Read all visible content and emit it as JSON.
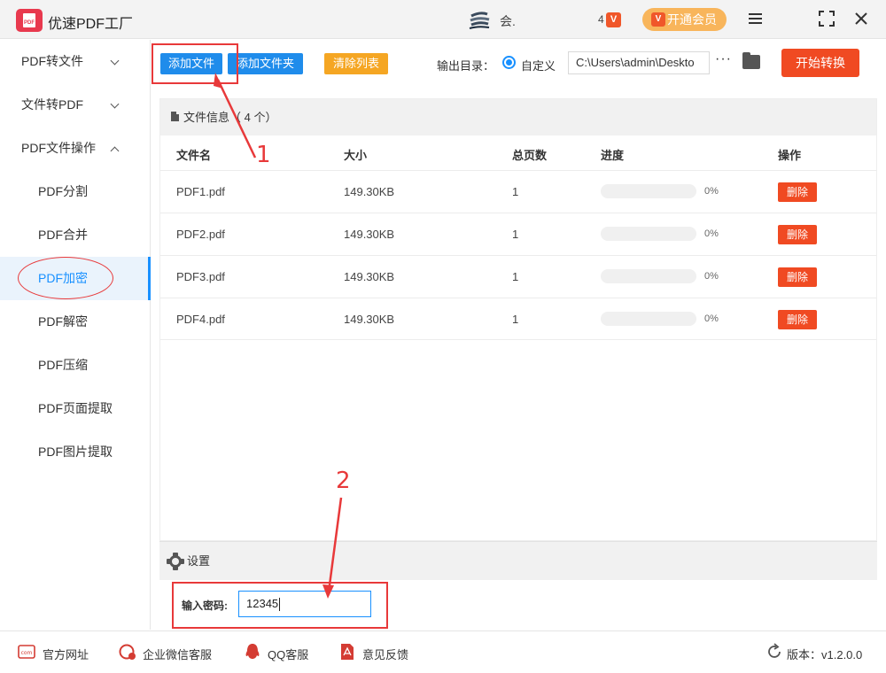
{
  "window": {
    "title": "优速PDF工厂",
    "logo_text": "PDF",
    "user_name": "会.",
    "vip_level": "4",
    "vip_badge": "V",
    "vip_button_label": "开通会员",
    "vip_button_badge": "V"
  },
  "sidebar": {
    "groups": [
      {
        "label": "PDF转文件",
        "expanded": false
      },
      {
        "label": "文件转PDF",
        "expanded": false
      },
      {
        "label": "PDF文件操作",
        "expanded": true
      }
    ],
    "items": [
      {
        "label": "PDF分割"
      },
      {
        "label": "PDF合并"
      },
      {
        "label": "PDF加密",
        "active": true
      },
      {
        "label": "PDF解密"
      },
      {
        "label": "PDF压缩"
      },
      {
        "label": "PDF页面提取"
      },
      {
        "label": "PDF图片提取"
      }
    ]
  },
  "toolbar": {
    "add_file": "添加文件",
    "add_folder": "添加文件夹",
    "clear_list": "清除列表",
    "output_label": "输出目录：",
    "radio_custom": "自定义",
    "output_path": "C:\\Users\\admin\\Deskto",
    "more": "···",
    "start": "开始转换"
  },
  "files": {
    "header": "文件信息（ 4 个）",
    "columns": [
      "文件名",
      "大小",
      "总页数",
      "进度",
      "操作"
    ],
    "rows": [
      {
        "name": "PDF1.pdf",
        "size": "149.30KB",
        "pages": "1",
        "progress": 0,
        "progress_text": "0%",
        "action": "删除"
      },
      {
        "name": "PDF2.pdf",
        "size": "149.30KB",
        "pages": "1",
        "progress": 0,
        "progress_text": "0%",
        "action": "删除"
      },
      {
        "name": "PDF3.pdf",
        "size": "149.30KB",
        "pages": "1",
        "progress": 0,
        "progress_text": "0%",
        "action": "删除"
      },
      {
        "name": "PDF4.pdf",
        "size": "149.30KB",
        "pages": "1",
        "progress": 0,
        "progress_text": "0%",
        "action": "删除"
      }
    ]
  },
  "settings": {
    "title": "设置",
    "password_label": "输入密码:",
    "password_value": "12345"
  },
  "footer": {
    "website": "官方网址",
    "wechat": "企业微信客服",
    "qq": "QQ客服",
    "feedback": "意见反馈",
    "version": "版本：v1.2.0.0"
  },
  "annotations": {
    "step1": "1",
    "step2": "2"
  },
  "colors": {
    "primary": "#1890ff",
    "danger": "#f04a22",
    "warning": "#f5a623",
    "annotation": "#e8393a"
  }
}
